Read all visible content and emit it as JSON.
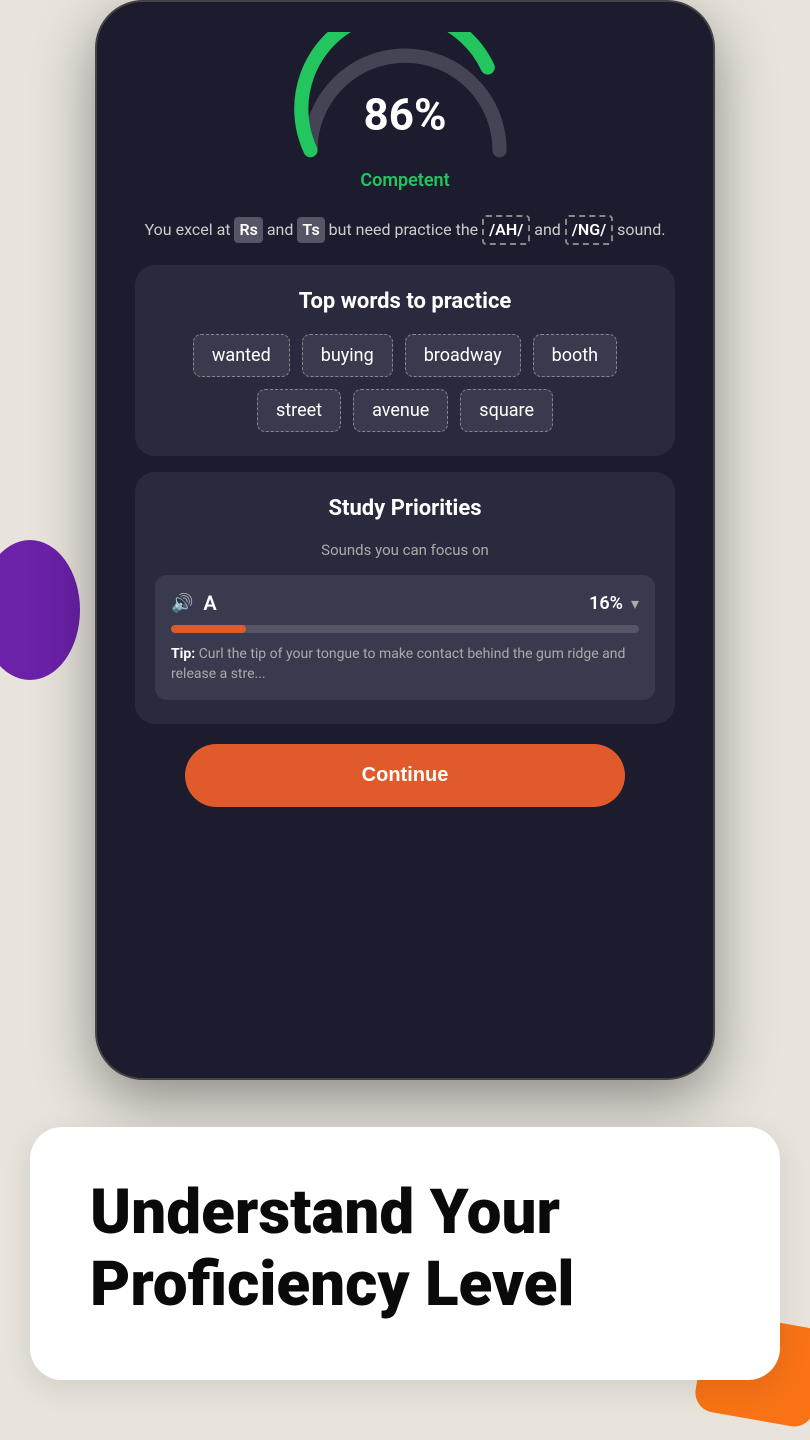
{
  "background_color": "#e8e4dc",
  "gauge": {
    "percent": "86",
    "percent_symbol": "%",
    "label": "Competent",
    "color_green": "#22c55e",
    "color_gray": "#555566"
  },
  "description": {
    "text_before": "You excel at",
    "highlight1": "Rs",
    "and1": "and",
    "highlight2": "Ts",
    "text_middle": "but need practice the",
    "sound1": "/AH/",
    "and2": "and",
    "sound2": "/NG/",
    "text_after": "sound."
  },
  "top_words": {
    "title": "Top words to practice",
    "words": [
      "wanted",
      "buying",
      "broadway",
      "booth",
      "street",
      "avenue",
      "square"
    ]
  },
  "study_priorities": {
    "title": "Study Priorities",
    "subtitle": "Sounds you can focus on",
    "item": {
      "letter": "A",
      "percent": "16%",
      "progress": 16,
      "tip_label": "Tip:",
      "tip_text": "Curl the tip of your tongue to make contact behind the gum ridge and release a stre..."
    }
  },
  "continue_button": {
    "label": "Continue"
  },
  "bottom_card": {
    "title": "Understand Your Proficiency Level"
  }
}
